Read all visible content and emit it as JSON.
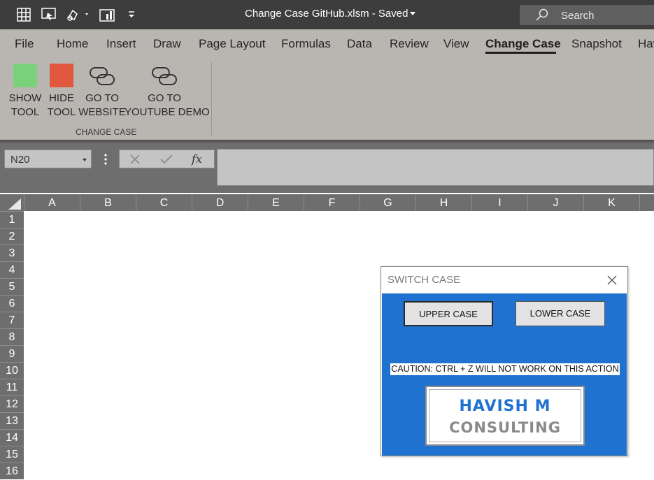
{
  "titlebar": {
    "title": "Change Case GitHub.xlsm  -  Saved",
    "search_label": "Search",
    "quick_access": [
      "grid-icon",
      "presenter-icon",
      "shapes-icon",
      "chart-icon",
      "customize-icon"
    ]
  },
  "ribbon": {
    "tabs": [
      "File",
      "Home",
      "Insert",
      "Draw",
      "Page Layout",
      "Formulas",
      "Data",
      "Review",
      "View",
      "Change Case",
      "Snapshot",
      "Hav"
    ],
    "active_tab": "Change Case",
    "buttons": {
      "show_tool": [
        "SHOW",
        "TOOL"
      ],
      "hide_tool": [
        "HIDE",
        "TOOL"
      ],
      "go_website": [
        "GO TO",
        "WEBSITE"
      ],
      "go_youtube": [
        "GO TO",
        "YOUTUBE DEMO"
      ]
    },
    "group_label": "CHANGE CASE",
    "colors": {
      "show": "#7bd17b",
      "hide": "#e2573f"
    }
  },
  "formula_bar": {
    "name_box": "N20",
    "fx": "fx",
    "formula_value": ""
  },
  "grid": {
    "columns": [
      "A",
      "B",
      "C",
      "D",
      "E",
      "F",
      "G",
      "H",
      "I",
      "J",
      "K"
    ],
    "rows": [
      "1",
      "2",
      "3",
      "4",
      "5",
      "6",
      "7",
      "8",
      "9",
      "10",
      "11",
      "12",
      "13",
      "14",
      "15",
      "16"
    ]
  },
  "dialog": {
    "title": "SWITCH CASE",
    "upper_button": "UPPER CASE",
    "lower_button": "LOWER CASE",
    "caution": "CAUTION: CTRL + Z WILL NOT WORK ON THIS ACTION",
    "logo_line1": "HAVISH M",
    "logo_line2": "CONSULTING",
    "colors": {
      "body": "#1f72cf"
    }
  }
}
